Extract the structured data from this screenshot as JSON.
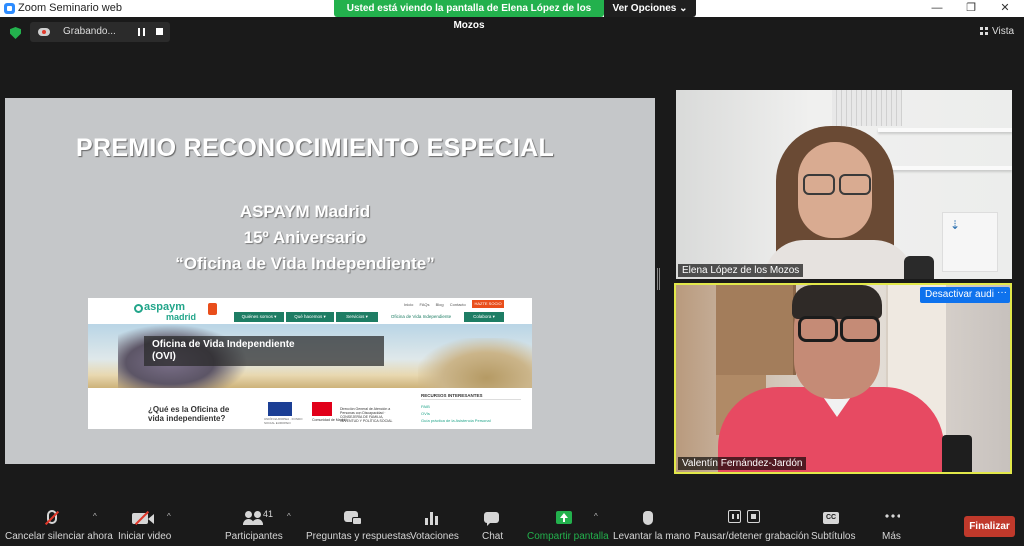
{
  "window": {
    "title": "Zoom Seminario web",
    "minimize_glyph": "—",
    "maximize_glyph": "❐",
    "close_glyph": "✕"
  },
  "share_banner": {
    "text": "Usted está viendo la pantalla de Elena López de los Mozos",
    "view_options": "Ver Opciones ⌄"
  },
  "recording": {
    "label": "Grabando..."
  },
  "layout_button": {
    "label": "Vista"
  },
  "slide": {
    "title": "PREMIO RECONOCIMIENTO ESPECIAL",
    "line1": "ASPAYM Madrid",
    "line2": "15º Aniversario",
    "line3": "“Oficina de Vida Independiente”",
    "website": {
      "logo_top": "aspaym",
      "logo_bottom": "madrid",
      "top_links": [
        "Inicio",
        "FAQs",
        "Blog",
        "Contacto"
      ],
      "cta": "HAZTE SOCIO",
      "nav": [
        "Quiénes somos ▾",
        "Qué hacemos ▾",
        "Servicios ▾",
        "Oficina de Vida Independiente",
        "Colabora ▾"
      ],
      "hero_line1": "Oficina de Vida Independiente",
      "hero_line2": "(OVI)",
      "question_line1": "¿Qué es la Oficina de",
      "question_line2": "vida independiente?",
      "eu_caption": "UNIÓN EUROPEA · FONDO SOCIAL EUROPEO",
      "cm_caption": "Comunidad de Madrid",
      "cm_desc": "Dirección General de Atención a Personas con Discapacidad · CONSEJERÍA DE FAMILIA, JUVENTUD Y POLÍTICA SOCIAL",
      "resources_title": "RECURSOS INTERESANTES",
      "resources": [
        "PAIB",
        "OVIs",
        "Guía práctica de la Asistencia Personal"
      ]
    }
  },
  "participants": [
    {
      "name": "Elena López de los Mozos"
    },
    {
      "name": "Valentín Fernández-Jardón",
      "unmute_button": "Desactivar audio",
      "more_button": "···"
    }
  ],
  "toolbar": {
    "mute": "Cancelar silenciar ahora",
    "video": "Iniciar video",
    "participants": "Participantes",
    "participants_count": "41",
    "qa": "Preguntas y respuestas",
    "polls": "Votaciones",
    "chat": "Chat",
    "share": "Compartir pantalla",
    "raise_hand": "Levantar la mano",
    "recording": "Pausar/detener grabación",
    "captions": "Subtítulos",
    "captions_icon": "CC",
    "more": "Más",
    "end": "Finalizar",
    "caret": "^"
  },
  "colors": {
    "share_green": "#23b14d",
    "active_speaker": "#e2e84a",
    "end_red": "#c0392b",
    "zoom_blue": "#0e72ed"
  }
}
